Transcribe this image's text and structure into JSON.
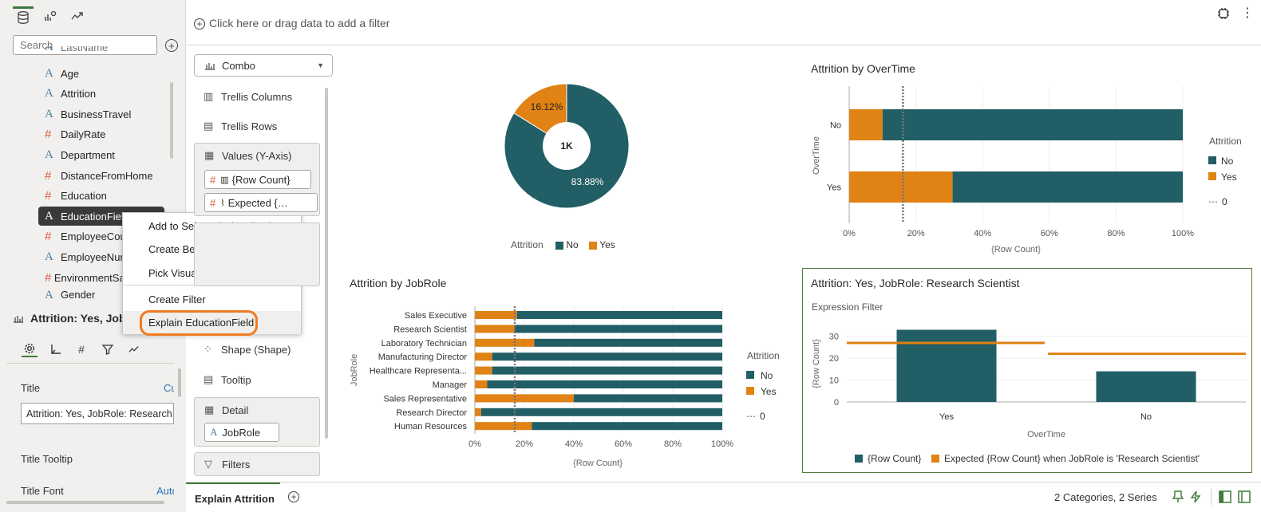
{
  "filter_bar": {
    "placeholder": "Click here or drag data to add a filter"
  },
  "left_panel": {
    "search_placeholder": "Search",
    "truncated_top": "LastName",
    "columns": [
      {
        "label": "Age",
        "type": "attribute"
      },
      {
        "label": "Attrition",
        "type": "attribute"
      },
      {
        "label": "BusinessTravel",
        "type": "attribute"
      },
      {
        "label": "DailyRate",
        "type": "measure"
      },
      {
        "label": "Department",
        "type": "attribute"
      },
      {
        "label": "DistanceFromHome",
        "type": "measure"
      },
      {
        "label": "Education",
        "type": "measure"
      },
      {
        "label": "EducationField",
        "type": "attribute",
        "selected": true
      },
      {
        "label": "EmployeeCount",
        "type": "measure"
      },
      {
        "label": "EmployeeNumber",
        "type": "attribute"
      },
      {
        "label": "EnvironmentSatisfaction",
        "type": "measure"
      },
      {
        "label": "Gender",
        "type": "attribute"
      }
    ]
  },
  "context_menu": {
    "items": [
      "Add to Selected Visualization",
      "Create Best Visualization",
      "Pick Visualization...",
      "Create Filter",
      "Explain EducationField"
    ]
  },
  "properties": {
    "viz_title": "Attrition: Yes, JobRole: Research Scientist",
    "title_label": "Title",
    "title_mode": "Custom",
    "title_value": "Attrition: Yes, JobRole: Research Scientist",
    "tooltip_label": "Title Tooltip",
    "font_label": "Title Font",
    "font_mode": "Auto"
  },
  "grammar": {
    "viz_type": "Combo",
    "trellis_columns": "Trellis Columns",
    "trellis_rows": "Trellis Rows",
    "values_label": "Values (Y-Axis)",
    "values_pills": [
      "{Row Count}",
      "Expected {Row Count} when JobRole is 'Research Scientist'"
    ],
    "shape": "Shape (Shape)",
    "tooltip": "Tooltip",
    "detail": "Detail",
    "detail_pill": "JobRole",
    "filters": "Filters"
  },
  "donut": {
    "center_label": "1K",
    "no_pct": "83.88%",
    "yes_pct": "16.12%",
    "legend_title": "Attrition",
    "legend": [
      "No",
      "Yes"
    ]
  },
  "overtime_chart": {
    "title": "Attrition by OverTime",
    "y_axis_label": "OverTime",
    "x_axis_label": "{Row Count}",
    "legend_title": "Attrition",
    "legend": [
      "No",
      "Yes"
    ],
    "legend_extra": "0"
  },
  "jobrole_chart": {
    "title": "Attrition by JobRole",
    "y_axis_label": "JobRole",
    "x_axis_label": "{Row Count}",
    "legend_title": "Attrition",
    "legend": [
      "No",
      "Yes"
    ],
    "legend_extra": "0"
  },
  "explain_chart": {
    "title": "Attrition: Yes, JobRole: Research Scientist",
    "subtitle": "Expression Filter",
    "y_axis_label": "{Row Count}",
    "x_axis_label": "OverTime",
    "legend": [
      "{Row Count}",
      "Expected {Row Count} when JobRole is 'Research Scientist'"
    ]
  },
  "chart_data": [
    {
      "type": "pie",
      "categories": [
        "No",
        "Yes"
      ],
      "values": [
        83.88,
        16.12
      ],
      "center": "1K"
    },
    {
      "type": "bar",
      "orientation": "horizontal",
      "stacked": "percent",
      "categories": [
        "No",
        "Yes"
      ],
      "series": [
        {
          "name": "Yes",
          "values": [
            10,
            31
          ]
        },
        {
          "name": "No",
          "values": [
            90,
            69
          ]
        }
      ],
      "reference_line": 16.12,
      "xticks": [
        "0%",
        "20%",
        "40%",
        "60%",
        "80%",
        "100%"
      ]
    },
    {
      "type": "bar",
      "orientation": "horizontal",
      "stacked": "percent",
      "categories": [
        "Sales Executive",
        "Research Scientist",
        "Laboratory Technician",
        "Manufacturing Director",
        "Healthcare Representa...",
        "Manager",
        "Sales Representative",
        "Research Director",
        "Human Resources"
      ],
      "series": [
        {
          "name": "Yes",
          "values": [
            17,
            16,
            24,
            7,
            7,
            5,
            40,
            2.5,
            23
          ]
        },
        {
          "name": "No",
          "values": [
            83,
            84,
            76,
            93,
            93,
            95,
            60,
            97.5,
            77
          ]
        }
      ],
      "reference_line": 16.12,
      "xticks": [
        "0%",
        "20%",
        "40%",
        "60%",
        "80%",
        "100%"
      ]
    },
    {
      "type": "bar",
      "categories": [
        "Yes",
        "No"
      ],
      "series": [
        {
          "name": "{Row Count}",
          "values": [
            33,
            14
          ]
        },
        {
          "name": "Expected {Row Count} when JobRole is 'Research Scientist'",
          "values": [
            27,
            22
          ]
        }
      ],
      "ylim": [
        0,
        35
      ],
      "yticks": [
        0,
        10,
        20,
        30
      ]
    }
  ],
  "bottom_bar": {
    "tab": "Explain Attrition",
    "status": "2 Categories, 2 Series"
  },
  "colors": {
    "no": "#225e66",
    "yes": "#e08214",
    "accent": "#3e7a3a",
    "highlight": "#ef7b22"
  }
}
